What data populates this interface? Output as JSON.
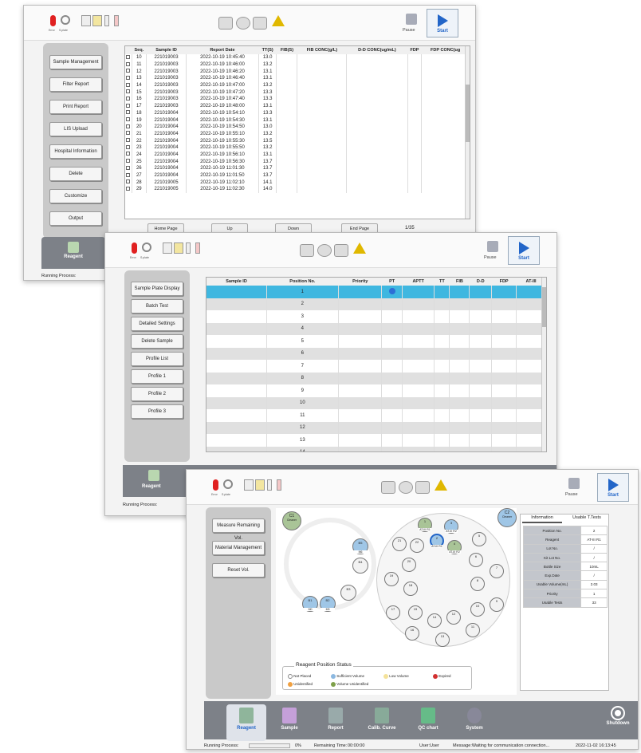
{
  "toolbar": {
    "error": "Error",
    "splate": "S.plate",
    "waste": "Waste",
    "waste2": "Waste",
    "cuvette": "Cuvette",
    "temp": "Temp",
    "hc": "HC",
    "lis": "LIS",
    "prt": "PRT",
    "ais": "AIS",
    "pause": "Pause",
    "start": "Start"
  },
  "win1": {
    "sidebar": [
      "Sample Management",
      "Filter Report",
      "Print Report",
      "LIS Upload",
      "Hospital Information",
      "Delete",
      "Customize",
      "Output"
    ],
    "columns": [
      "Seq.",
      "Sample ID",
      "Report Date",
      "TT(S)",
      "FIB(S)",
      "FIB CONC(g/L)",
      "D-D CONC(ug/mL)",
      "FDP",
      "FDP CONC(ug"
    ],
    "rows": [
      [
        "10",
        "221019003",
        "2022-10-19 10:45:40",
        "13.0"
      ],
      [
        "11",
        "221019003",
        "2022-10-19 10:46:00",
        "13.2"
      ],
      [
        "12",
        "221019003",
        "2022-10-19 10:46:20",
        "13.1"
      ],
      [
        "13",
        "221019003",
        "2022-10-19 10:46:40",
        "13.1"
      ],
      [
        "14",
        "221019003",
        "2022-10-19 10:47:00",
        "13.2"
      ],
      [
        "15",
        "221019003",
        "2022-10-19 10:47:20",
        "13.3"
      ],
      [
        "16",
        "221019003",
        "2022-10-19 10:47:40",
        "13.3"
      ],
      [
        "17",
        "221019003",
        "2022-10-19 10:48:00",
        "13.1"
      ],
      [
        "18",
        "221019004",
        "2022-10-19 10:54:10",
        "13.3"
      ],
      [
        "19",
        "221019004",
        "2022-10-19 10:54:30",
        "13.1"
      ],
      [
        "20",
        "221019004",
        "2022-10-19 10:54:50",
        "13.0"
      ],
      [
        "21",
        "221019004",
        "2022-10-19 10:55:10",
        "13.2"
      ],
      [
        "22",
        "221019004",
        "2022-10-19 10:55:30",
        "13.5"
      ],
      [
        "23",
        "221019004",
        "2022-10-19 10:55:50",
        "13.2"
      ],
      [
        "24",
        "221019004",
        "2022-10-19 10:56:10",
        "13.1"
      ],
      [
        "25",
        "221019004",
        "2022-10-19 10:56:30",
        "13.7"
      ],
      [
        "26",
        "221019004",
        "2022-10-19 11:01:30",
        "13.7"
      ],
      [
        "27",
        "221019004",
        "2022-10-19 11:01:50",
        "13.7"
      ],
      [
        "28",
        "221019005",
        "2022-10-19 11:02:10",
        "14.1"
      ],
      [
        "29",
        "221019005",
        "2022-10-19 11:02:30",
        "14.0"
      ]
    ],
    "nav": {
      "home": "Home Page",
      "up": "Up",
      "down": "Down",
      "end": "End Page",
      "page": "1/35"
    },
    "reagent": "Reagent",
    "running": "Running Process:"
  },
  "win2": {
    "sidebar": [
      "Sample Plate Display",
      "Batch Test",
      "Detailed Settings",
      "Delete Sample",
      "Profile List",
      "Profile 1",
      "Profile 2",
      "Profile 3"
    ],
    "columns": [
      "Sample ID",
      "Position No.",
      "Priority",
      "PT",
      "APTT",
      "TT",
      "FIB",
      "D-D",
      "FDP",
      "AT-III"
    ],
    "rows": [
      "1",
      "2",
      "3",
      "4",
      "5",
      "6",
      "7",
      "8",
      "9",
      "10",
      "11",
      "12",
      "13",
      "14"
    ],
    "reagent": "Reagent",
    "running": "Running Process:"
  },
  "win3": {
    "sidebar": [
      "Measure Remaining Vol.",
      "Material Management",
      "Reset Vol."
    ],
    "cleaner": "Cleaner",
    "c1": "C1",
    "c2": "C2",
    "outer": {
      "b5": "B5",
      "b4": "B4",
      "b3": "B3",
      "b2": "B2",
      "b1": "B1",
      "b5s": "M6",
      "b2s": "M3",
      "b1s": "M0"
    },
    "inner": {
      "p1": "1",
      "p2": "2",
      "p3": "3",
      "p4": "4",
      "p5": "5",
      "p6": "6",
      "p7": "7",
      "p8": "8",
      "p9": "9",
      "p10": "10",
      "p11": "11",
      "p12": "12",
      "p13": "13",
      "p14": "14",
      "p15": "15",
      "p16": "16",
      "p17": "17",
      "p18": "18",
      "p19": "19",
      "p20": "20",
      "p21": "21",
      "p22": "22",
      "r1": "AT-III R1",
      "r2": "AT-III R2",
      "r3": "AT-III R1",
      "r4": "AT-III R2"
    },
    "legend": {
      "title": "Reagent Position Status",
      "not_placed": "Not Placed",
      "sufficient": "Sufficient Volume",
      "low": "Low Volume",
      "expired": "Expired",
      "unidentified": "Unidentified",
      "vol_unid": "Volume Unidentified"
    },
    "info_tabs": [
      "Information",
      "Usable T.Tests"
    ],
    "info": [
      [
        "Position No.",
        "2"
      ],
      [
        "Reagent",
        "AT-III R1"
      ],
      [
        "Lot No.",
        "/"
      ],
      [
        "Kit Lot No.",
        "/"
      ],
      [
        "Bottle Size",
        "10mL"
      ],
      [
        "Exp.Date",
        "/"
      ],
      [
        "Usable Volume(mL)",
        "2.03"
      ],
      [
        "Priority",
        "1"
      ],
      [
        "Usable Tests",
        "33"
      ]
    ],
    "nav": [
      "Reagent",
      "Sample",
      "Report",
      "Calib. Curve",
      "QC chart",
      "System",
      "Shutdown"
    ],
    "status": {
      "running": "Running Process:",
      "pct": "0%",
      "remaining": "Remaining Time:",
      "time": "00:00:00",
      "user": "User:User",
      "message": "Message:Waiting for communication connection...",
      "datetime": "2022-11-02 16:13:45"
    }
  }
}
